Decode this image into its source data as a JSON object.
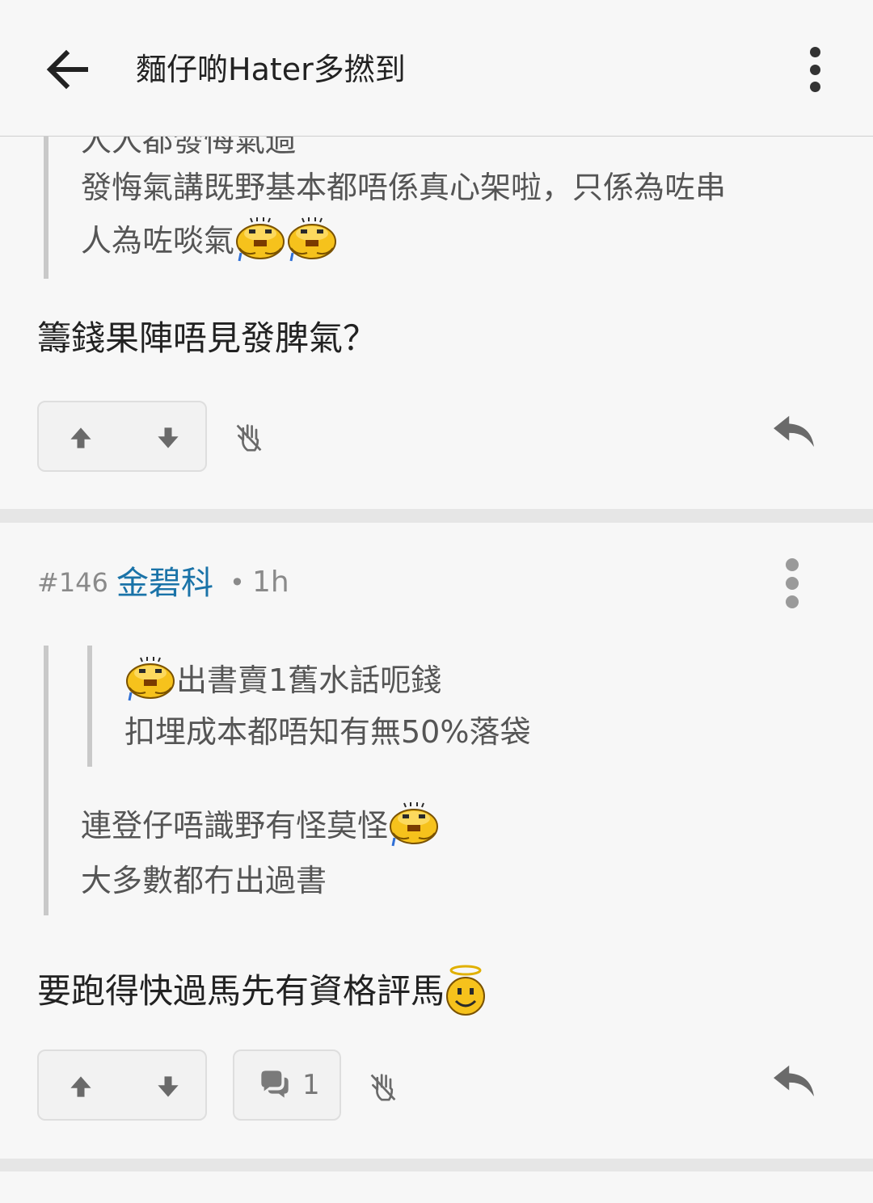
{
  "header": {
    "title": "麵仔啲Hater多撚到",
    "back_icon": "arrow-left-icon",
    "menu_icon": "more-vertical-icon"
  },
  "post_top": {
    "quote_cut_line": "人人都發悔氣過",
    "quote_line_1": "發悔氣講既野基本都唔係真心架啦，只係為咗串",
    "quote_line_2": "人為咗啖氣",
    "reply_text": "籌錢果陣唔見發脾氣？"
  },
  "post_146": {
    "number": "#146",
    "username": "金碧科",
    "separator": "•",
    "time": "1h",
    "inner_quote_line_1": "出書賣1舊水話呃錢",
    "inner_quote_line_2": "扣埋成本都唔知有無50%落袋",
    "outer_quote_line_1": "連登仔唔識野有怪莫怪",
    "outer_quote_line_2": "大多數都冇出過書",
    "reply_text": "要跑得快過馬先有資格評馬",
    "comment_count": "1"
  },
  "colors": {
    "username": "#1a73a8",
    "background": "#f7f7f7",
    "divider": "#e6e6e6",
    "quote_bar": "#c9c9c9"
  }
}
